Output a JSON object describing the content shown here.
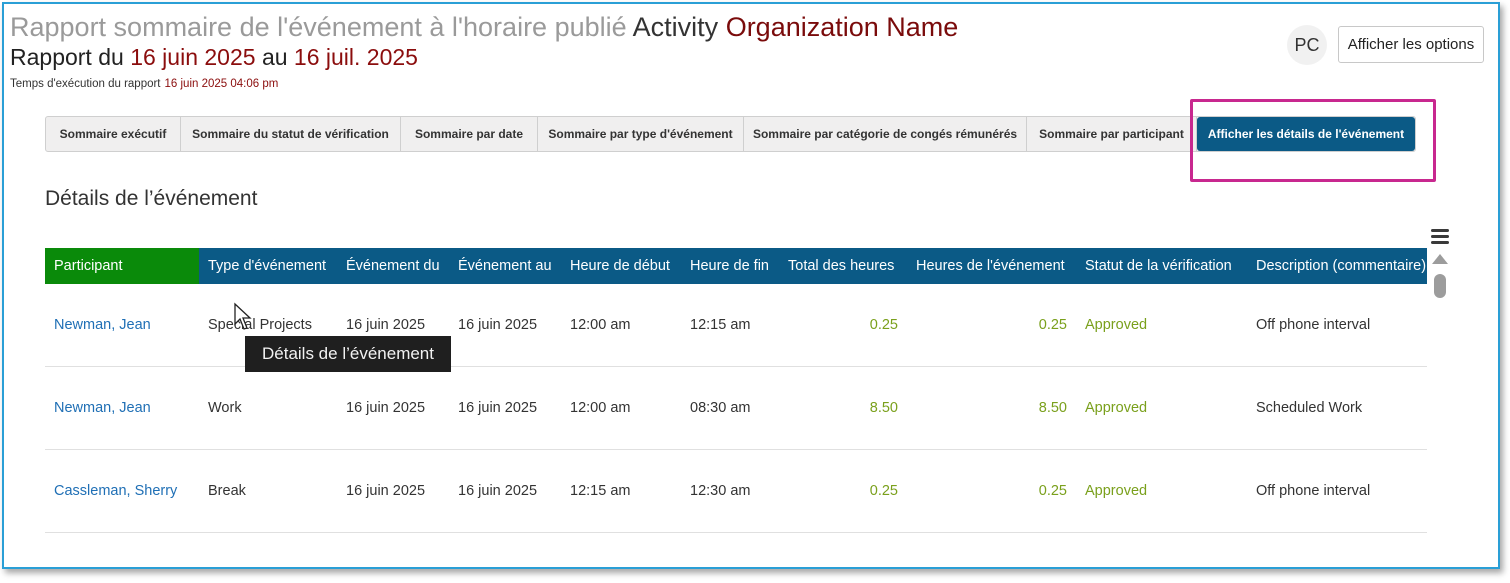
{
  "header": {
    "title_prefix": "Rapport sommaire de l'événement à l'horaire publié",
    "title_activity": "Activity",
    "title_org": "Organization Name",
    "range_label": "Rapport du",
    "range_start": "16 juin 2025",
    "range_sep": "au",
    "range_end": "16 juil. 2025",
    "exec_label": "Temps d'exécution du rapport",
    "exec_value": "16 juin 2025 04:06 pm",
    "avatar_initials": "PC",
    "options_button": "Afficher les options"
  },
  "tabs": [
    {
      "label": "Sommaire exécutif",
      "active": false
    },
    {
      "label": "Sommaire du statut de vérification",
      "active": false
    },
    {
      "label": "Sommaire par date",
      "active": false
    },
    {
      "label": "Sommaire par type d'événement",
      "active": false
    },
    {
      "label": "Sommaire par catégorie de congés rémunérés",
      "active": false
    },
    {
      "label": "Sommaire par participant",
      "active": false
    },
    {
      "label": "Afficher les détails de l'événement",
      "active": true
    }
  ],
  "section_title": "Détails de l’événement",
  "table": {
    "columns": [
      "Participant",
      "Type d'événement",
      "Événement du",
      "Événement au",
      "Heure de début",
      "Heure de fin",
      "Total des heures",
      "Heures de l'événement",
      "Statut de la vérification",
      "Description (commentaire)"
    ],
    "rows": [
      [
        "Newman, Jean",
        "Special Projects",
        "16 juin 2025",
        "16 juin 2025",
        "12:00 am",
        "12:15 am",
        "0.25",
        "0.25",
        "Approved",
        "Off phone interval"
      ],
      [
        "Newman, Jean",
        "Work",
        "16 juin 2025",
        "16 juin 2025",
        "12:00 am",
        "08:30 am",
        "8.50",
        "8.50",
        "Approved",
        "Scheduled Work"
      ],
      [
        "Cassleman, Sherry",
        "Break",
        "16 juin 2025",
        "16 juin 2025",
        "12:15 am",
        "12:30 am",
        "0.25",
        "0.25",
        "Approved",
        "Off phone interval"
      ]
    ]
  },
  "tooltip": "Détails de l’événement",
  "colors": {
    "accent": "#0b5a86",
    "participant_header": "#0a8a0a",
    "approved": "#7aa01c",
    "highlight": "#c8288f"
  }
}
